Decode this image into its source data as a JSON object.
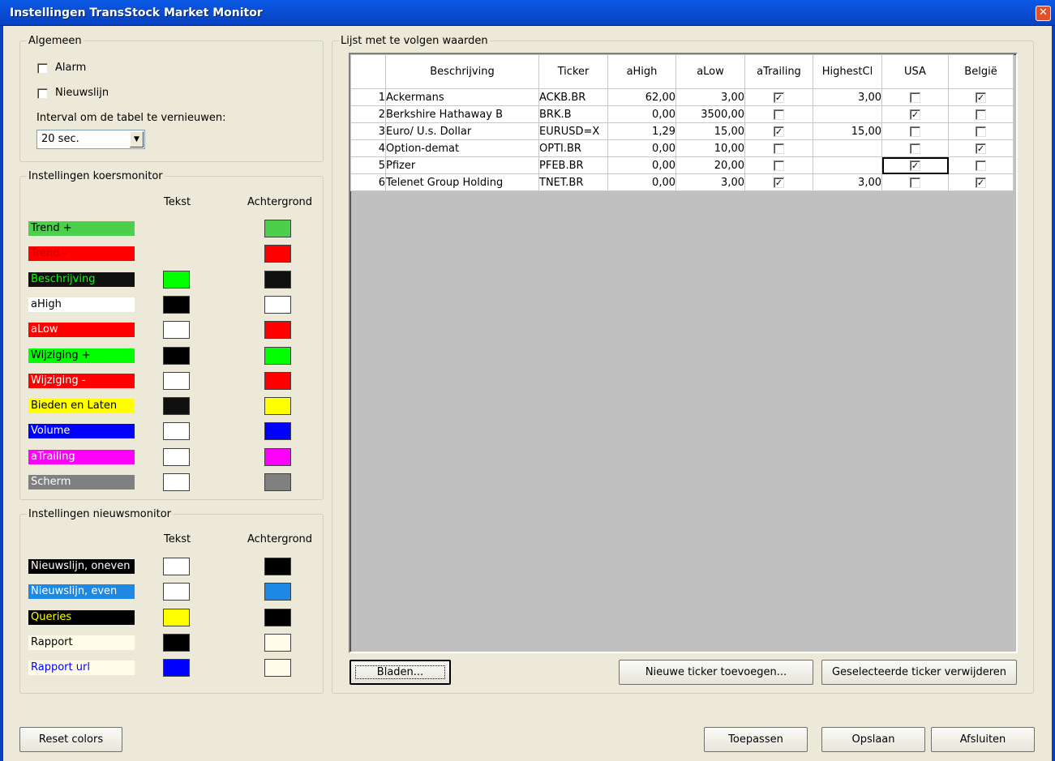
{
  "window": {
    "title": "Instellingen TransStock Market Monitor",
    "close_glyph": "✕"
  },
  "algemeen": {
    "legend": "Algemeen",
    "alarm": {
      "label": "Alarm",
      "checked": false
    },
    "nieuwslijn": {
      "label": "Nieuwslijn",
      "checked": false
    },
    "interval_label": "Interval om de tabel te vernieuwen:",
    "interval_value": "20 sec."
  },
  "koersmonitor": {
    "legend": "Instellingen koersmonitor",
    "col_text": "Tekst",
    "col_background": "Achtergrond",
    "rows": [
      {
        "label": "Trend +",
        "label_fg": "#000000",
        "label_bg": "#4cd04c",
        "text_color": null,
        "bg_color": "#4cd04c"
      },
      {
        "label": "Trend -",
        "label_fg": "#c00000",
        "label_bg": "#ff0000",
        "text_color": null,
        "bg_color": "#ff0000"
      },
      {
        "label": "Beschrijving",
        "label_fg": "#00ff00",
        "label_bg": "#101010",
        "text_color": "#00ff00",
        "bg_color": "#101010"
      },
      {
        "label": "aHigh",
        "label_fg": "#000000",
        "label_bg": "#ffffff",
        "text_color": "#000000",
        "bg_color": "#ffffff"
      },
      {
        "label": "aLow",
        "label_fg": "#ffffff",
        "label_bg": "#ff0000",
        "text_color": "#ffffff",
        "bg_color": "#ff0000"
      },
      {
        "label": "Wijziging +",
        "label_fg": "#000000",
        "label_bg": "#00ff00",
        "text_color": "#000000",
        "bg_color": "#00ff00"
      },
      {
        "label": "Wijziging -",
        "label_fg": "#ffffff",
        "label_bg": "#ff0000",
        "text_color": "#ffffff",
        "bg_color": "#ff0000"
      },
      {
        "label": "Bieden en Laten",
        "label_fg": "#000000",
        "label_bg": "#ffff00",
        "text_color": "#101010",
        "bg_color": "#ffff00"
      },
      {
        "label": "Volume",
        "label_fg": "#ffffff",
        "label_bg": "#0000ff",
        "text_color": "#ffffff",
        "bg_color": "#0000ff"
      },
      {
        "label": "aTrailing",
        "label_fg": "#ffffff",
        "label_bg": "#ff00ff",
        "text_color": "#ffffff",
        "bg_color": "#ff00ff"
      },
      {
        "label": "Scherm",
        "label_fg": "#ffffff",
        "label_bg": "#808080",
        "text_color": "#ffffff",
        "bg_color": "#808080"
      }
    ]
  },
  "nieuwsmonitor": {
    "legend": "Instellingen nieuwsmonitor",
    "col_text": "Tekst",
    "col_background": "Achtergrond",
    "rows": [
      {
        "label": "Nieuwslijn, oneven",
        "label_fg": "#ffffff",
        "label_bg": "#000000",
        "text_color": "#ffffff",
        "bg_color": "#000000"
      },
      {
        "label": "Nieuwslijn, even",
        "label_fg": "#ffffff",
        "label_bg": "#1e88e5",
        "text_color": "#ffffff",
        "bg_color": "#1e88e5"
      },
      {
        "label": "Queries",
        "label_fg": "#ffff00",
        "label_bg": "#000000",
        "text_color": "#ffff00",
        "bg_color": "#000000"
      },
      {
        "label": "Rapport",
        "label_fg": "#000000",
        "label_bg": "#fffde8",
        "text_color": "#000000",
        "bg_color": "#fffde8"
      },
      {
        "label": "Rapport url",
        "label_fg": "#0000ff",
        "label_bg": "#fffde8",
        "text_color": "#0000ff",
        "bg_color": "#fffde8"
      }
    ]
  },
  "watchlist": {
    "legend": "Lijst met te volgen waarden",
    "columns": [
      "",
      "Beschrijving",
      "Ticker",
      "aHigh",
      "aLow",
      "aTrailing",
      "HighestCl",
      "USA",
      "België"
    ],
    "rows": [
      {
        "n": "1",
        "beschrijving": "Ackermans",
        "ticker": "ACKB.BR",
        "ahigh": "62,00",
        "alow": "3,00",
        "atrailing": true,
        "highestcl": "3,00",
        "usa": false,
        "belgie": true
      },
      {
        "n": "2",
        "beschrijving": "Berkshire Hathaway  B",
        "ticker": "BRK.B",
        "ahigh": "0,00",
        "alow": "3500,00",
        "atrailing": false,
        "highestcl": "",
        "usa": true,
        "belgie": false
      },
      {
        "n": "3",
        "beschrijving": "Euro/ U.s. Dollar",
        "ticker": "EURUSD=X",
        "ahigh": "1,29",
        "alow": "15,00",
        "atrailing": true,
        "highestcl": "15,00",
        "usa": false,
        "belgie": false
      },
      {
        "n": "4",
        "beschrijving": "Option-demat",
        "ticker": "OPTI.BR",
        "ahigh": "0,00",
        "alow": "10,00",
        "atrailing": false,
        "highestcl": "",
        "usa": false,
        "belgie": true
      },
      {
        "n": "5",
        "beschrijving": "Pfizer",
        "ticker": "PFEB.BR",
        "ahigh": "0,00",
        "alow": "20,00",
        "atrailing": false,
        "highestcl": "",
        "usa": true,
        "belgie": false
      },
      {
        "n": "6",
        "beschrijving": "Telenet Group Holding",
        "ticker": "TNET.BR",
        "ahigh": "0,00",
        "alow": "3,00",
        "atrailing": true,
        "highestcl": "3,00",
        "usa": false,
        "belgie": true
      }
    ],
    "browse_button": "Bladen...",
    "add_button": "Nieuwe ticker toevoegen...",
    "remove_button": "Geselecteerde ticker verwijderen"
  },
  "footer": {
    "reset_button": "Reset colors",
    "apply_button": "Toepassen",
    "save_button": "Opslaan",
    "close_button": "Afsluiten"
  },
  "check_glyph": "✓"
}
